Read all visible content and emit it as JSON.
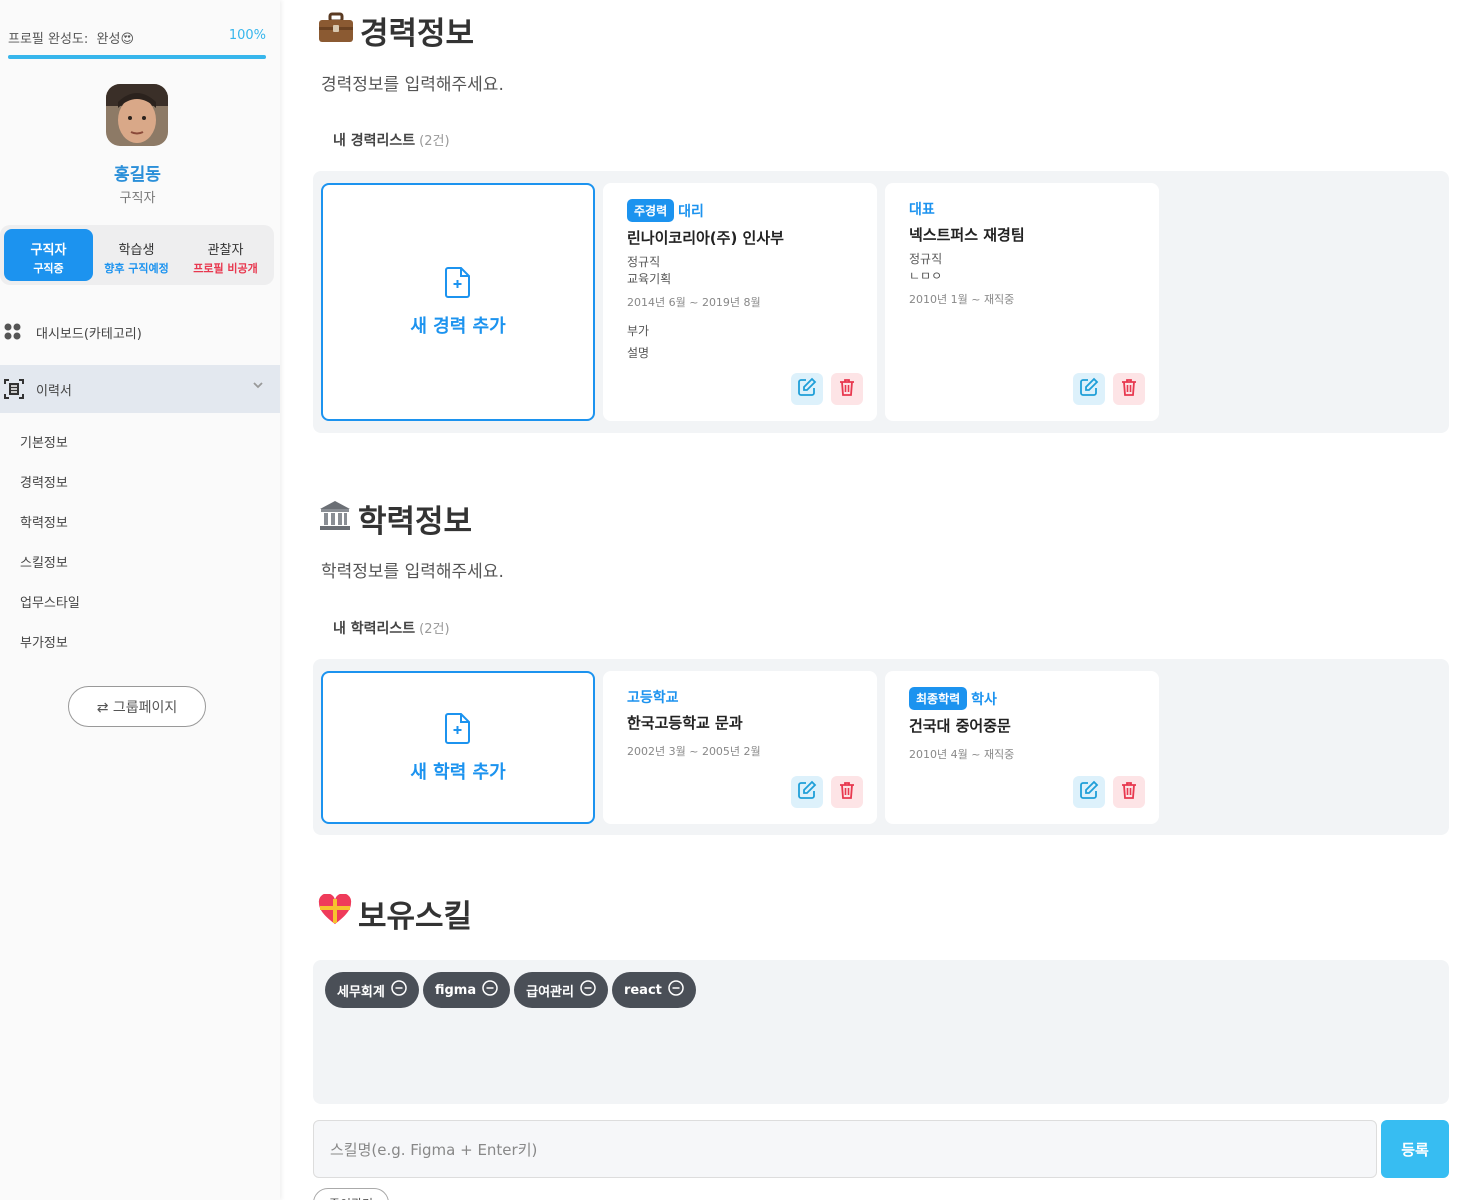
{
  "sidebar": {
    "profile": {
      "label": "프로필 완성도:",
      "status": "완성😍",
      "percent_text": "100%",
      "percent": 1.0
    },
    "user": {
      "name": "홍길동",
      "role": "구직자"
    },
    "modes": [
      {
        "title": "구직자",
        "sub": "구직중",
        "active": true
      },
      {
        "title": "학습생",
        "sub": "향후 구직예정",
        "sub_color": "#1c93ef"
      },
      {
        "title": "관찰자",
        "sub": "프로필 비공개",
        "sub_color": "#e8384f"
      }
    ],
    "nav": {
      "dashboard": "대시보드(카테고리)",
      "resume": "이력서"
    },
    "sub_items": [
      "기본정보",
      "경력정보",
      "학력정보",
      "스킬정보",
      "업무스타일",
      "부가정보"
    ],
    "group_button": "⇄ 그룹페이지"
  },
  "career": {
    "title": "경력정보",
    "icon": "briefcase-icon",
    "desc": "경력정보를 입력해주세요.",
    "list_label": "내 경력리스트",
    "count": "(2건)",
    "add_label": "새 경력 추가",
    "cards": [
      {
        "badge": "주경력",
        "position": "대리",
        "company": "린나이코리아(주) 인사부",
        "lines": [
          "정규직",
          "교육기획"
        ],
        "date": "2014년 6월 ~ 2019년 8월",
        "extra": [
          "부가",
          "설명"
        ]
      },
      {
        "badge": "",
        "position": "대표",
        "company": "넥스트퍼스 재경팀",
        "lines": [
          "정규직",
          "ㄴㅁㅇ"
        ],
        "date": "2010년 1월 ~ 재직중",
        "extra": []
      }
    ]
  },
  "education": {
    "title": "학력정보",
    "icon": "bank-icon",
    "desc": "학력정보를 입력해주세요.",
    "list_label": "내 학력리스트",
    "count": "(2건)",
    "add_label": "새 학력 추가",
    "cards": [
      {
        "badge": "",
        "position": "고등학교",
        "school": "한국고등학교 문과",
        "date": "2002년 3월 ~ 2005년 2월"
      },
      {
        "badge": "최종학력",
        "position": "학사",
        "school": "건국대 중어중문",
        "date": "2010년 4월 ~ 재직중"
      }
    ]
  },
  "skills": {
    "title": "보유스킬",
    "icon": "heart-gift-icon",
    "items": [
      "세무회계",
      "figma",
      "급여관리",
      "react"
    ],
    "input_placeholder": "스킬명(e.g. Figma + Enter키)",
    "register_label": "등록",
    "extra_button": "종이관리"
  },
  "colors": {
    "accent": "#1c93ef",
    "danger": "#e8384f",
    "chip": "#4a4f57",
    "panel": "#f2f4f6"
  }
}
